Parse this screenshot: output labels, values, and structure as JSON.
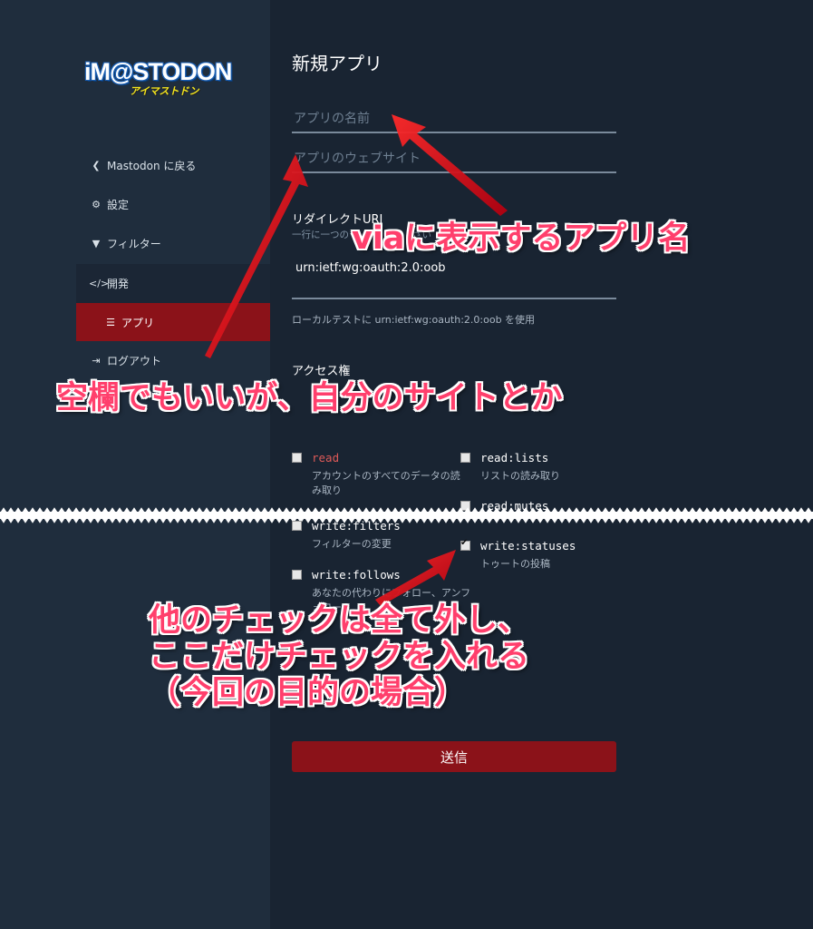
{
  "logo": {
    "main": "iM@STODON",
    "sub": "アイマストドン"
  },
  "sidebar": {
    "items": [
      {
        "label": "Mastodon に戻る",
        "icon": "chevron-left-icon"
      },
      {
        "label": "設定",
        "icon": "gear-icon"
      },
      {
        "label": "フィルター",
        "icon": "filter-icon"
      },
      {
        "label": "開発",
        "icon": "code-icon"
      },
      {
        "label": "アプリ",
        "icon": "list-icon"
      },
      {
        "label": "ログアウト",
        "icon": "sign-out-icon"
      }
    ]
  },
  "page": {
    "title": "新規アプリ",
    "app_name_placeholder": "アプリの名前",
    "website_placeholder": "アプリのウェブサイト",
    "redirect_label": "リダイレクトURI",
    "redirect_hint": "一行に一つの",
    "redirect_hint_end": "さい",
    "redirect_value": "urn:ietf:wg:oauth:2.0:oob",
    "redirect_note": "ローカルテストに urn:ietf:wg:oauth:2.0:oob を使用",
    "access_label": "アクセス権",
    "submit_label": "送信"
  },
  "scopes": [
    {
      "name": "read",
      "desc": "アカウントのすべてのデータの読み取り",
      "checked": false
    },
    {
      "name": "read:lists",
      "desc": "リストの読み取り",
      "checked": false
    },
    {
      "name": "read:mutes",
      "desc": "",
      "checked": false
    },
    {
      "name": "write:filters",
      "desc": "フィルターの変更",
      "checked": false
    },
    {
      "name": "write:statuses",
      "desc": "トゥートの投稿",
      "checked": true
    },
    {
      "name": "write:follows",
      "desc": "あなたの代わりにフォロー、アンフォロー",
      "checked": false
    }
  ],
  "annotations": {
    "a1": "viaに表示するアプリ名",
    "a2": "空欄でもいいが、自分のサイトとか",
    "a3_line1": "他のチェックは全て外し、",
    "a3_line2": "ここだけチェックを入れる",
    "a3_line3": "（今回の目的の場合）"
  },
  "colors": {
    "accent_red": "#8b1219",
    "annotation": "#ff3f6c",
    "arrow": "#e8141c"
  }
}
